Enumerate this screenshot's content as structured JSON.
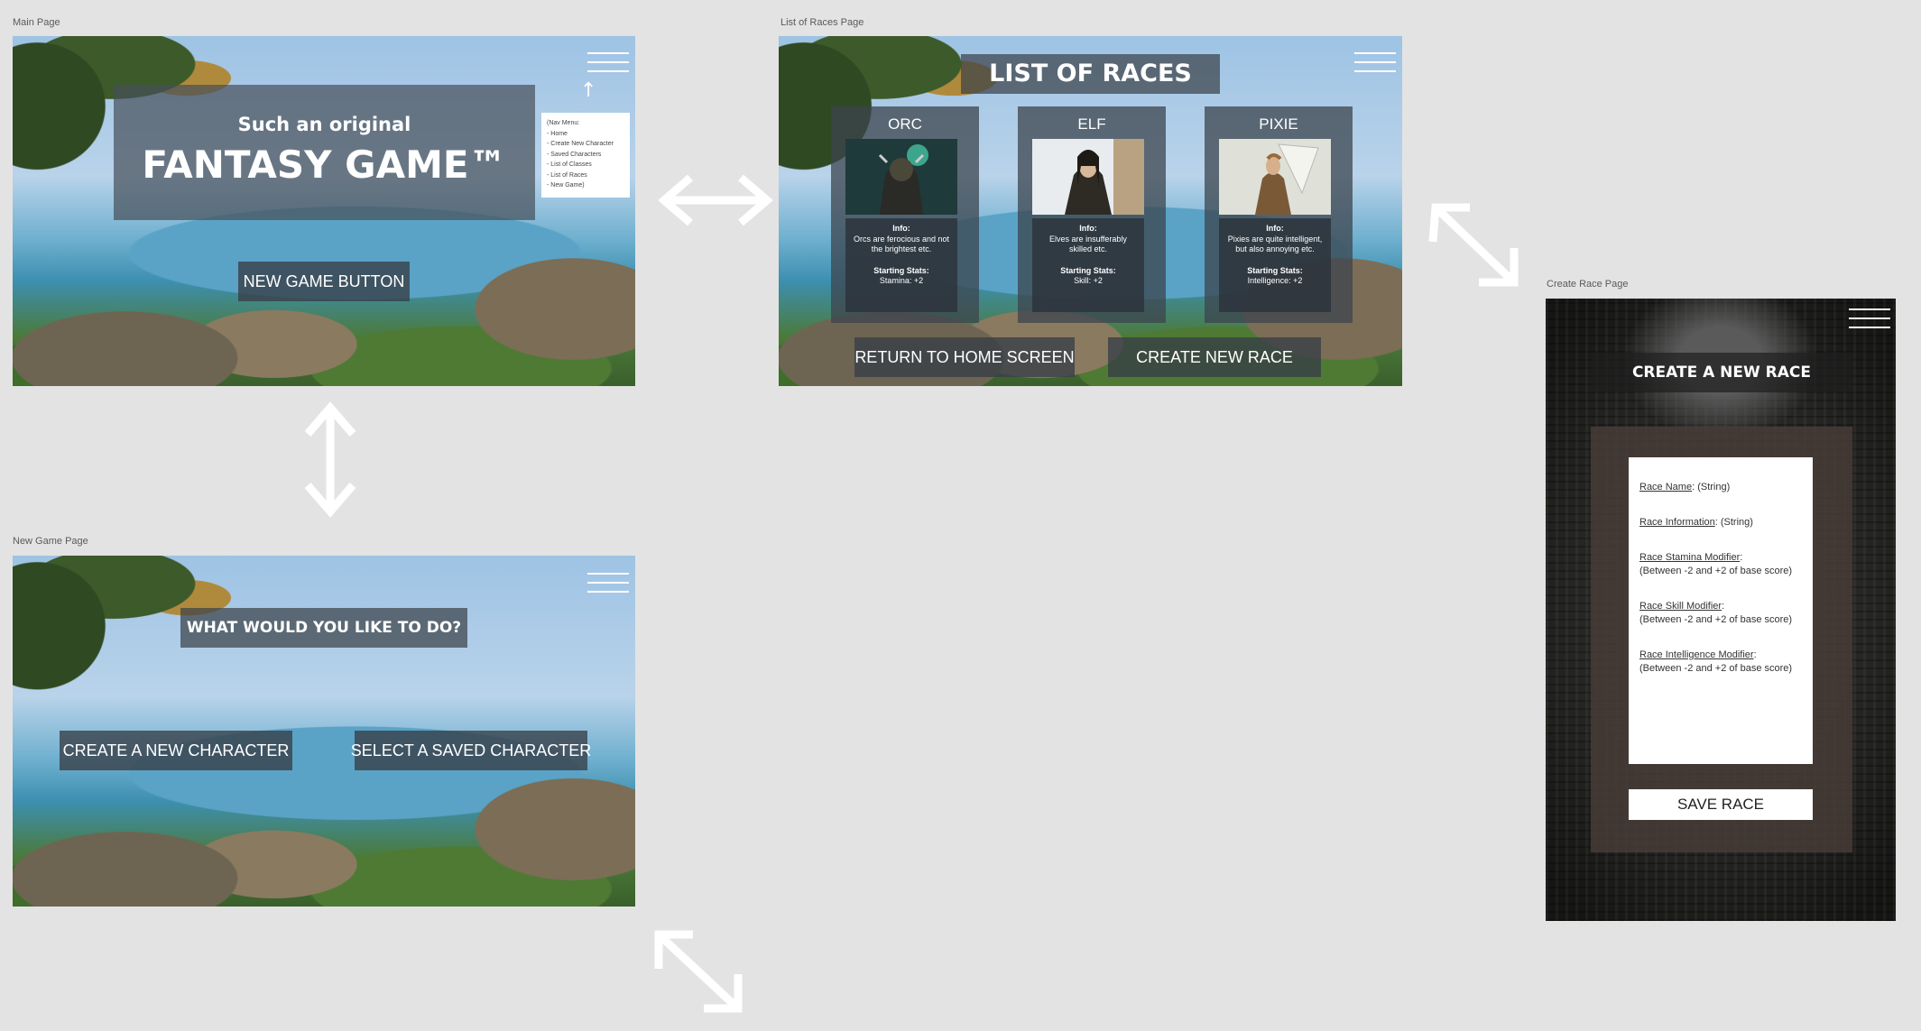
{
  "artboards": {
    "main": "Main Page",
    "races": "List of Races Page",
    "create_race": "Create Race Page",
    "new_game": "New Game Page"
  },
  "main_page": {
    "subtitle": "Such an original",
    "title": "FANTASY GAME™",
    "new_game_button": "NEW GAME BUTTON",
    "up_arrow": "↑",
    "nav_menu": [
      "(Nav Menu:",
      "- Home",
      "- Create New Character",
      "- Saved Characters",
      "- List of Classes",
      "- List of Races",
      "- New Game)"
    ]
  },
  "races_page": {
    "title": "LIST OF RACES",
    "races": [
      {
        "name": "ORC",
        "info_label": "Info:",
        "info": "Orcs are ferocious and not the brightest etc.",
        "stats_label": "Starting Stats:",
        "stats": "Stamina: +2"
      },
      {
        "name": "ELF",
        "info_label": "Info:",
        "info": "Elves are insufferably skilled etc.",
        "stats_label": "Starting Stats:",
        "stats": "Skill: +2"
      },
      {
        "name": "PIXIE",
        "info_label": "Info:",
        "info": "Pixies are quite intelligent, but also annoying etc.",
        "stats_label": "Starting Stats:",
        "stats": "Intelligence: +2"
      }
    ],
    "return_button": "RETURN TO HOME SCREEN",
    "create_button": "CREATE NEW RACE"
  },
  "create_race_page": {
    "title": "CREATE A NEW RACE",
    "fields": [
      {
        "label": "Race Name",
        "desc": ": (String)"
      },
      {
        "label": "Race Information",
        "desc": ": (String)"
      },
      {
        "label": "Race Stamina Modifier",
        "desc": ":",
        "desc2": "(Between -2 and +2 of base score)"
      },
      {
        "label": "Race Skill Modifier",
        "desc": ":",
        "desc2": "(Between -2 and +2 of base score)"
      },
      {
        "label": "Race Intelligence Modifier",
        "desc": ":",
        "desc2": "(Between -2 and +2 of base score)"
      }
    ],
    "save_button": "SAVE RACE"
  },
  "new_game_page": {
    "title": "WHAT WOULD YOU LIKE TO DO?",
    "create_button": "CREATE A NEW CHARACTER",
    "select_button": "SELECT A SAVED CHARACTER"
  },
  "colors": {
    "canvas": "#e3e3e3",
    "panel_dark": "#3c424a",
    "text_light": "#ffffff"
  }
}
